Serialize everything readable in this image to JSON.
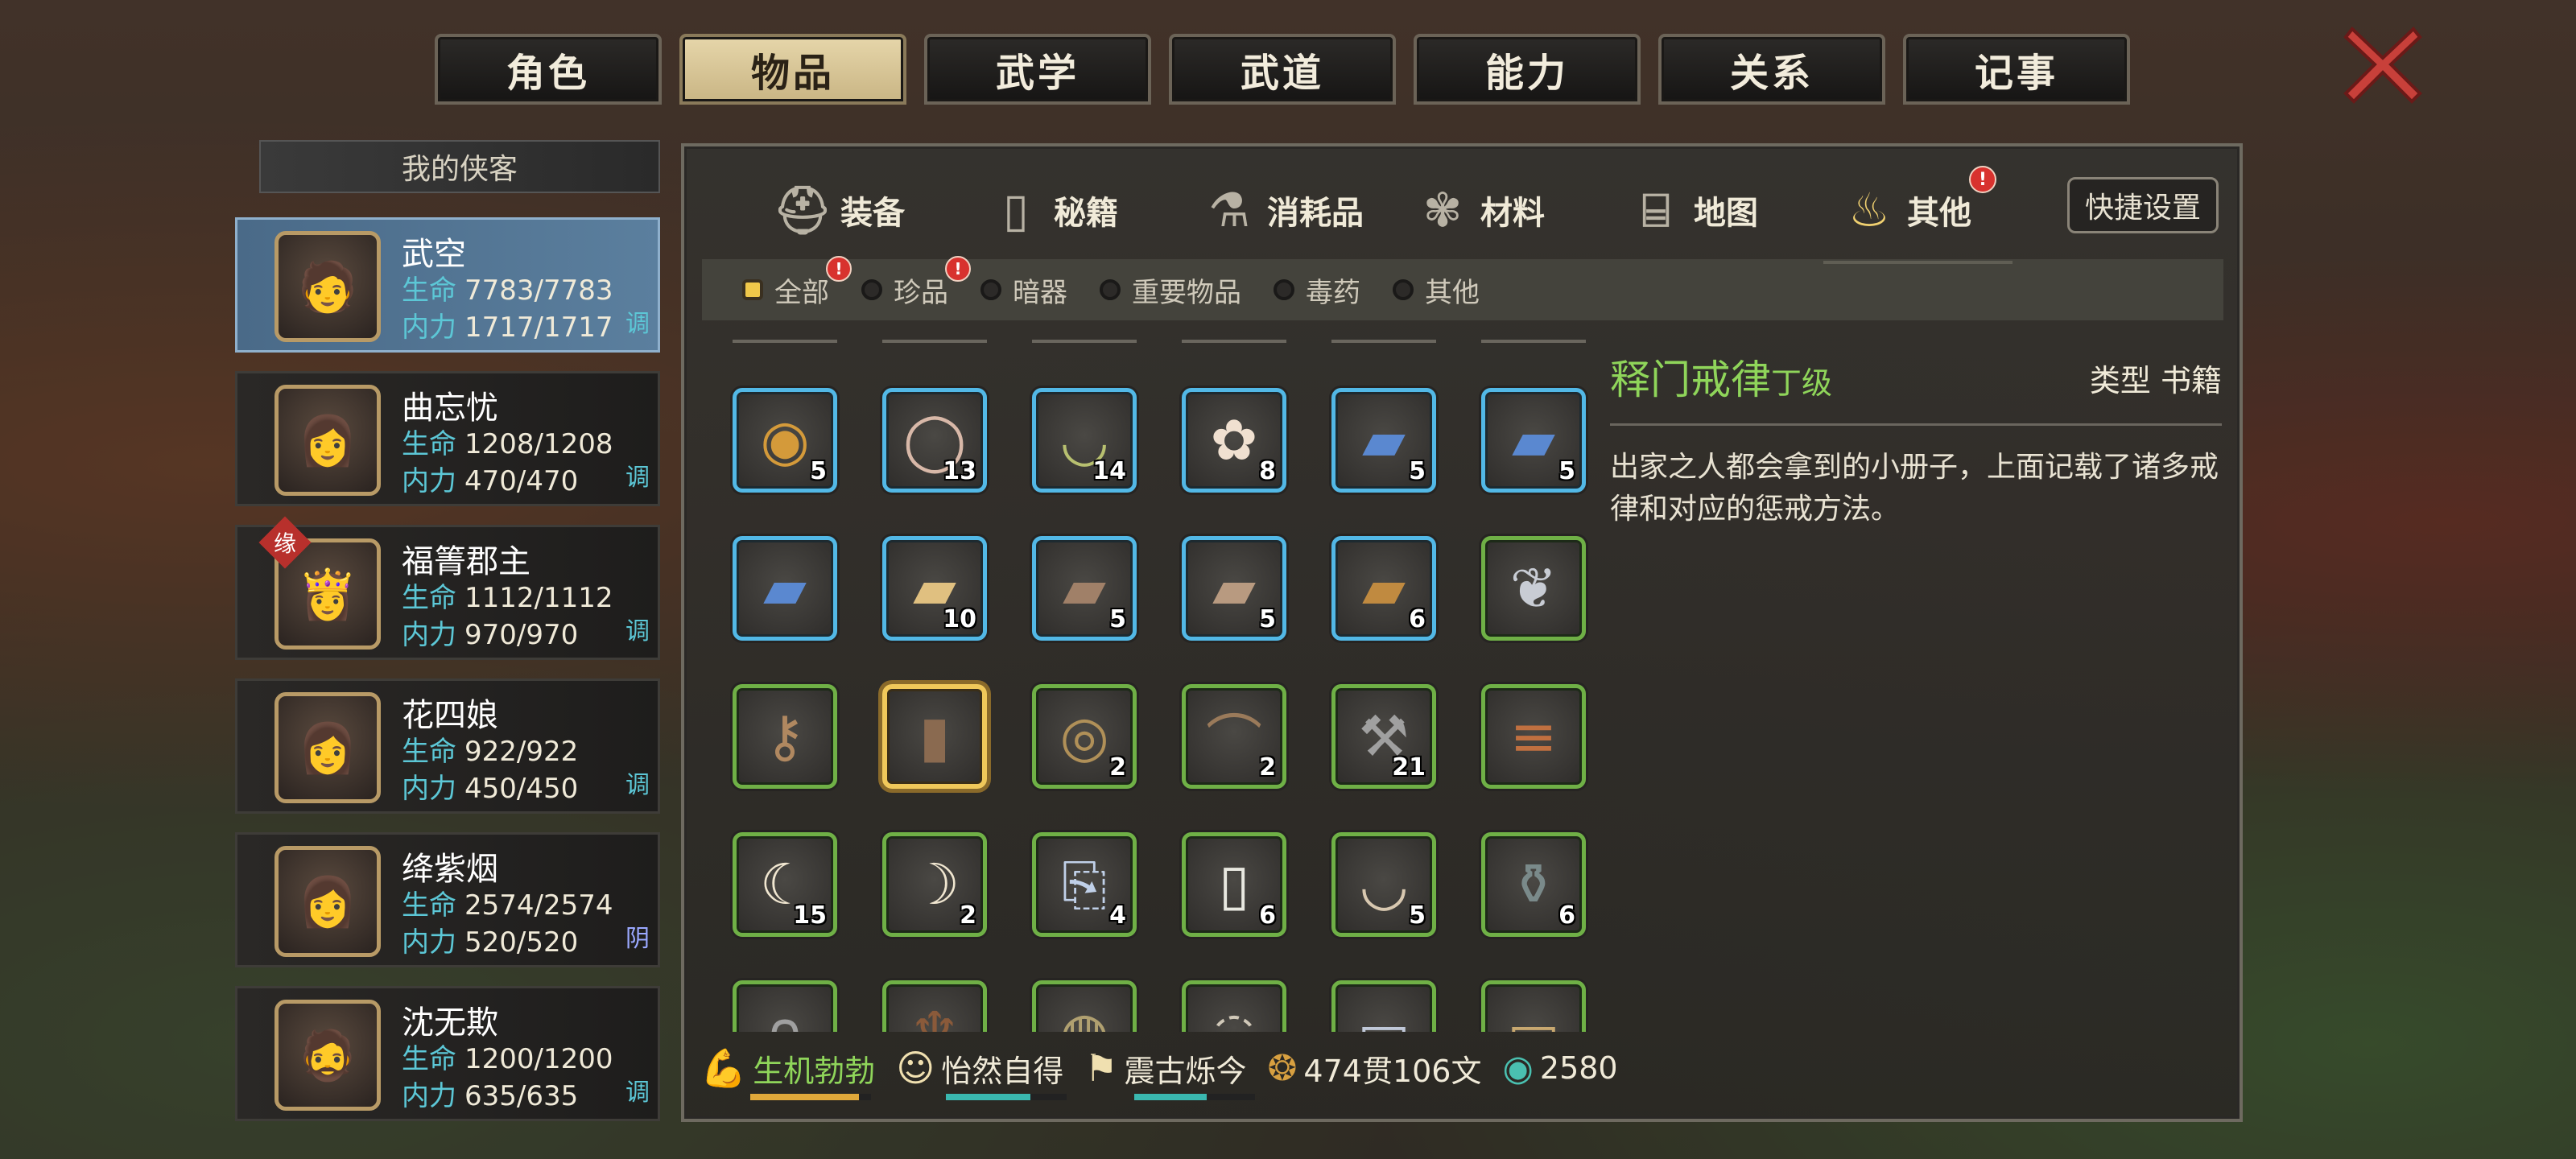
{
  "top_tabs": [
    {
      "label": "角色",
      "active": false,
      "badge": false
    },
    {
      "label": "物品",
      "active": true,
      "badge": true
    },
    {
      "label": "武学",
      "active": false,
      "badge": true
    },
    {
      "label": "武道",
      "active": false,
      "badge": false
    },
    {
      "label": "能力",
      "active": false,
      "badge": false
    },
    {
      "label": "关系",
      "active": false,
      "badge": false
    },
    {
      "label": "记事",
      "active": false,
      "badge": false
    }
  ],
  "badge_mark": "!",
  "roster": {
    "header": "我的侠客",
    "hp_key": "生命",
    "mp_key": "内力",
    "fate_mark": "缘",
    "characters": [
      {
        "name": "武空",
        "hp": "7783/7783",
        "mp": "1717/1717",
        "tag": "调",
        "active": true
      },
      {
        "name": "曲忘忧",
        "hp": "1208/1208",
        "mp": "470/470",
        "tag": "调"
      },
      {
        "name": "福箐郡主",
        "hp": "1112/1112",
        "mp": "970/970",
        "tag": "调",
        "fate": true
      },
      {
        "name": "花四娘",
        "hp": "922/922",
        "mp": "450/450",
        "tag": "调"
      },
      {
        "name": "绛紫烟",
        "hp": "2574/2574",
        "mp": "520/520",
        "tag": "阴"
      },
      {
        "name": "沈无欺",
        "hp": "1200/1200",
        "mp": "635/635",
        "tag": "调"
      }
    ]
  },
  "categories": [
    {
      "label": "装备",
      "icon": "helmet-icon"
    },
    {
      "label": "秘籍",
      "icon": "book-icon"
    },
    {
      "label": "消耗品",
      "icon": "potion-icon"
    },
    {
      "label": "材料",
      "icon": "herb-icon"
    },
    {
      "label": "地图",
      "icon": "map-icon"
    },
    {
      "label": "其他",
      "icon": "lamp-icon",
      "active": true,
      "badge": true
    }
  ],
  "quick_settings": "快捷设置",
  "filters": [
    {
      "label": "全部",
      "on": true,
      "badge": true
    },
    {
      "label": "珍品",
      "badge": true
    },
    {
      "label": "暗器"
    },
    {
      "label": "重要物品"
    },
    {
      "label": "毒药"
    },
    {
      "label": "其他"
    }
  ],
  "items": [
    {
      "icon": "coin-icon",
      "count": "5",
      "rarity": "blue",
      "glyph": "◉",
      "color": "#d49a3a"
    },
    {
      "icon": "ring-icon",
      "count": "13",
      "rarity": "blue",
      "glyph": "◯",
      "color": "#d8b8a8"
    },
    {
      "icon": "bowl-icon",
      "count": "14",
      "rarity": "blue",
      "glyph": "◡",
      "color": "#b8c070"
    },
    {
      "icon": "lotus-icon",
      "count": "8",
      "rarity": "blue",
      "glyph": "✿",
      "color": "#f0e0d0"
    },
    {
      "icon": "blue-book-icon",
      "count": "5",
      "rarity": "blue",
      "glyph": "▰",
      "color": "#5a88d0"
    },
    {
      "icon": "blue-book-icon",
      "count": "5",
      "rarity": "blue",
      "glyph": "▰",
      "color": "#5a88d0"
    },
    {
      "icon": "blue-book-icon",
      "count": "",
      "rarity": "blue",
      "glyph": "▰",
      "color": "#5a88d0"
    },
    {
      "icon": "red-book-icon",
      "count": "10",
      "rarity": "blue",
      "glyph": "▰",
      "color": "#e0c080"
    },
    {
      "icon": "brown-book-icon",
      "count": "5",
      "rarity": "blue",
      "glyph": "▰",
      "color": "#a08068"
    },
    {
      "icon": "brown-book-icon",
      "count": "5",
      "rarity": "blue",
      "glyph": "▰",
      "color": "#b89a80"
    },
    {
      "icon": "brown-book-icon",
      "count": "6",
      "rarity": "blue",
      "glyph": "▰",
      "color": "#c08a40"
    },
    {
      "icon": "feather-icon",
      "count": "",
      "rarity": "green",
      "glyph": "❦",
      "color": "#c8ccd4"
    },
    {
      "icon": "key-icon",
      "count": "",
      "rarity": "green",
      "glyph": "⚷",
      "color": "#b08860"
    },
    {
      "icon": "manual-icon",
      "count": "",
      "rarity": "selected",
      "glyph": "▮",
      "color": "#8a6a50"
    },
    {
      "icon": "rope-icon",
      "count": "2",
      "rarity": "green",
      "glyph": "◎",
      "color": "#b09058"
    },
    {
      "icon": "fishing-rod-icon",
      "count": "2",
      "rarity": "green",
      "glyph": "⌒",
      "color": "#9a7a5a"
    },
    {
      "icon": "shovel-icon",
      "count": "21",
      "rarity": "green",
      "glyph": "⚒",
      "color": "#a0a0a0"
    },
    {
      "icon": "wood-planks-icon",
      "count": "",
      "rarity": "green",
      "glyph": "≡",
      "color": "#c07040"
    },
    {
      "icon": "fang-icon",
      "count": "15",
      "rarity": "green",
      "glyph": "☾",
      "color": "#f0e6d0"
    },
    {
      "icon": "claw-icon",
      "count": "2",
      "rarity": "green",
      "glyph": "☽",
      "color": "#f0e6d0"
    },
    {
      "icon": "scroll-icon",
      "count": "4",
      "rarity": "green",
      "glyph": "⎘",
      "color": "#c0d0e8"
    },
    {
      "icon": "paper-icon",
      "count": "6",
      "rarity": "green",
      "glyph": "▯",
      "color": "#e8e8e0"
    },
    {
      "icon": "dish-icon",
      "count": "5",
      "rarity": "green",
      "glyph": "◡",
      "color": "#d8c8b0"
    },
    {
      "icon": "jar-icon",
      "count": "6",
      "rarity": "green",
      "glyph": "⚱",
      "color": "#7a8a8a"
    },
    {
      "icon": "hook-icon",
      "count": "",
      "rarity": "green",
      "glyph": "∩",
      "color": "#a0a0a0"
    },
    {
      "icon": "pouch-icon",
      "count": "",
      "rarity": "green",
      "glyph": "♆",
      "color": "#8a5a3a"
    },
    {
      "icon": "plate-icon",
      "count": "",
      "rarity": "green",
      "glyph": "◍",
      "color": "#b0a070"
    },
    {
      "icon": "plate-icon",
      "count": "",
      "rarity": "green",
      "glyph": "◌",
      "color": "#d0c8b8"
    },
    {
      "icon": "scroll-icon",
      "count": "",
      "rarity": "green",
      "glyph": "▭",
      "color": "#c0c8d8"
    },
    {
      "icon": "map-scroll-icon",
      "count": "",
      "rarity": "green",
      "glyph": "▭",
      "color": "#c8a870"
    }
  ],
  "detail": {
    "name": "释门戒律",
    "grade": "丁级",
    "type": "类型  书籍",
    "description": "出家之人都会拿到的小册子，上面记载了诸多戒律和对应的惩戒方法。"
  },
  "status_bar": [
    {
      "label": "生机勃勃",
      "icon": "muscle-icon",
      "bar_color": "#e0a83a",
      "bar_fill": 0.9
    },
    {
      "label": "怡然自得",
      "icon": "face-icon",
      "bar_color": "#3ab8b0",
      "bar_fill": 0.7
    },
    {
      "label": "震古烁今",
      "icon": "banner-icon",
      "bar_color": "#3ab8b0",
      "bar_fill": 0.6
    }
  ],
  "money": {
    "copper": "474贯106文",
    "jade": "2580"
  }
}
